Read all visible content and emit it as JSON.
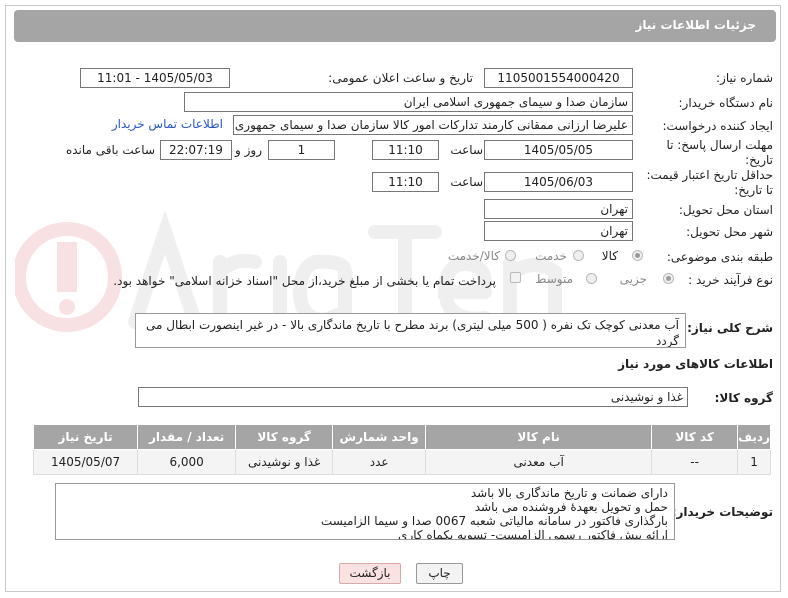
{
  "header": {
    "title": "جزئیات اطلاعات نیاز"
  },
  "form": {
    "need_number_label": "شماره نیاز:",
    "need_number": "1105001554000420",
    "announce_label": "تاریخ و ساعت اعلان عمومی:",
    "announce_value": "1405/05/03 - 11:01",
    "buyer_org_label": "نام دستگاه خریدار:",
    "buyer_org": "سازمان صدا و سیمای جمهوری اسلامی ایران",
    "requester_label": "ایجاد کننده درخواست:",
    "requester": "علیرضا ارزانی ممقانی کارمند تدارکات امور کالا سازمان صدا و سیمای جمهوری اسلامی ایران",
    "contact_link": "اطلاعات تماس خریدار",
    "deadline_label_1": "مهلت ارسال پاسخ: تا",
    "deadline_label_2": "تاریخ:",
    "deadline_date": "1405/05/05",
    "time_label": "ساعت",
    "deadline_time": "11:10",
    "days_value": "1",
    "days_label": "روز و",
    "remaining_time": "22:07:19",
    "remaining_label": "ساعت باقی مانده",
    "validity_label_1": "حداقل تاریخ اعتبار قیمت:",
    "validity_label_2": "تا تاریخ:",
    "validity_date": "1405/06/03",
    "validity_time": "11:10",
    "province_label": "استان محل تحویل:",
    "province": "تهران",
    "city_label": "شهر محل تحویل:",
    "city": "تهران",
    "category_label": "طبقه بندی موضوعی:",
    "category_options": [
      "کالا",
      "خدمت",
      "کالا/خدمت"
    ],
    "purchase_type_label": "نوع فرآیند خرید :",
    "purchase_options": [
      "جزیی",
      "متوسط"
    ],
    "payment_note": "پرداخت تمام یا بخشی از مبلغ خرید،از محل \"اسناد خزانه اسلامی\" خواهد بود."
  },
  "description": {
    "label": "شرح کلی نیاز:",
    "text": "آب معدنی کوچک تک نفره ( 500 میلی لیتری) برند مطرح با تاریخ ماندگاری بالا - در غیر اینصورت ابطال می گردد"
  },
  "goods_section": {
    "title": "اطلاعات کالاهای مورد نیاز",
    "group_label": "گروه کالا:",
    "group_value": "غذا و نوشیدنی"
  },
  "table": {
    "headers": [
      "ردیف",
      "کد کالا",
      "نام کالا",
      "واحد شمارش",
      "گروه کالا",
      "تعداد / مقدار",
      "تاریخ نیاز"
    ],
    "rows": [
      [
        "1",
        "--",
        "آب معدنی",
        "عدد",
        "غذا و نوشیدنی",
        "6,000",
        "1405/05/07"
      ]
    ]
  },
  "buyer_notes": {
    "label": "توضیحات خریدار:",
    "lines": [
      "دارای ضمانت و تاریخ ماندگاری بالا باشد",
      "حمل و تحویل بعهدهٔ فروشنده می باشد",
      "بارگذاری فاکتور در سامانه مالیاتی شعبه 0067 صدا و سیما الزامیست",
      "ارائه پیش فاکتور رسمی الزامیست- تسویه یکماه کاری"
    ]
  },
  "buttons": {
    "print": "چاپ",
    "back": "بازگشت"
  },
  "colors": {
    "header_bg": "#a5a5a5",
    "link": "#2a56c6",
    "back_bg": "#fbe2e2"
  }
}
